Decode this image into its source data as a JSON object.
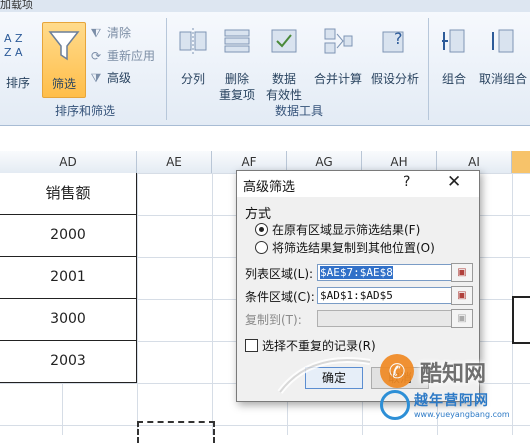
{
  "ribbon": {
    "top_label": "加载项",
    "sort_label": "排序",
    "filter_label": "筛选",
    "clear_label": "清除",
    "reapply_label": "重新应用",
    "advanced_label": "高级",
    "group_sort_filter": "排序和筛选",
    "text_to_columns": "分列",
    "remove_duplicates_1": "删除",
    "remove_duplicates_2": "重复项",
    "data_validation_1": "数据",
    "data_validation_2": "有效性",
    "consolidate": "合并计算",
    "what_if": "假设分析",
    "group_data_tools": "数据工具",
    "group": "组合",
    "ungroup": "取消组合"
  },
  "sheet": {
    "columns": [
      "AD",
      "AE",
      "AF",
      "AG",
      "AH",
      "AI"
    ],
    "header_cell": "销售额",
    "values": [
      "2000",
      "2001",
      "3000",
      "2003"
    ]
  },
  "dialog": {
    "title": "高级筛选",
    "help": "?",
    "close": "✕",
    "section_label": "方式",
    "radio_in_place": "在原有区域显示筛选结果(F)",
    "radio_copy_to": "将筛选结果复制到其他位置(O)",
    "list_range_label": "列表区域(L):",
    "list_range_value": "$AE$7:$AE$8",
    "criteria_range_label": "条件区域(C):",
    "criteria_range_value": "$AD$1:$AD$5",
    "copy_to_label": "复制到(T):",
    "copy_to_value": "",
    "unique_records_label": "选择不重复的记录(R)",
    "ok_label": "确定",
    "cancel_label": "取消"
  },
  "watermark": {
    "brand1": "酷知网",
    "brand2": "越年营阿网",
    "url": "www.yueyangbang.com"
  }
}
